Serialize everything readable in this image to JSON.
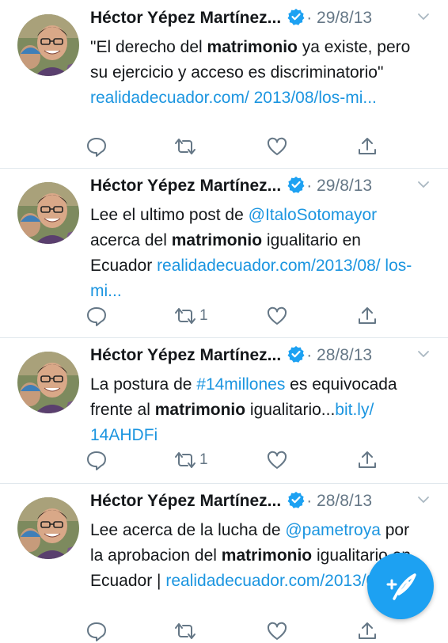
{
  "tweets": [
    {
      "author": "Héctor Yépez Martínez...",
      "date": "· 29/8/13",
      "text": [
        {
          "t": "\"El derecho del ",
          "k": "n"
        },
        {
          "t": "matrimonio",
          "k": "b"
        },
        {
          "t": " ya existe, pero su ejercicio y acceso es discriminatorio\" ",
          "k": "n"
        },
        {
          "t": "realidadecuador.com/ 2013/08/los-mi...",
          "k": "l"
        }
      ],
      "retweet_count": "",
      "like_count": ""
    },
    {
      "author": "Héctor Yépez Martínez...",
      "date": "· 29/8/13",
      "text": [
        {
          "t": "Lee el ultimo post de ",
          "k": "n"
        },
        {
          "t": "@ItaloSotomayor",
          "k": "l"
        },
        {
          "t": " acerca del ",
          "k": "n"
        },
        {
          "t": "matrimonio",
          "k": "b"
        },
        {
          "t": " igualitario en Ecuador ",
          "k": "n"
        },
        {
          "t": "realidadecuador.com/2013/08/ los-mi...",
          "k": "l"
        }
      ],
      "retweet_count": "1",
      "like_count": ""
    },
    {
      "author": "Héctor Yépez Martínez...",
      "date": "· 28/8/13",
      "text": [
        {
          "t": "La postura de ",
          "k": "n"
        },
        {
          "t": "#14millones",
          "k": "l"
        },
        {
          "t": " es equivocada frente al ",
          "k": "n"
        },
        {
          "t": "matrimonio",
          "k": "b"
        },
        {
          "t": " igualitario...",
          "k": "n"
        },
        {
          "t": "bit.ly/ 14AHDFi",
          "k": "l"
        }
      ],
      "retweet_count": "1",
      "like_count": ""
    },
    {
      "author": "Héctor Yépez Martínez...",
      "date": "· 28/8/13",
      "text": [
        {
          "t": "Lee acerca de la lucha de ",
          "k": "n"
        },
        {
          "t": "@pametroya",
          "k": "l"
        },
        {
          "t": " por la aprobacion del ",
          "k": "n"
        },
        {
          "t": "matrimonio",
          "k": "b"
        },
        {
          "t": " igualitario en Ecuador | ",
          "k": "n"
        },
        {
          "t": "realidadecuador.com/2013/08/los-",
          "k": "l"
        }
      ],
      "retweet_count": "",
      "like_count": ""
    }
  ],
  "icons": {
    "reply": "reply-icon",
    "retweet": "retweet-icon",
    "like": "heart-icon",
    "share": "share-icon",
    "verified": "verified-badge-icon",
    "caret": "chevron-down-icon",
    "compose": "compose-tweet-icon"
  },
  "colors": {
    "accent": "#1da1f2",
    "link": "#1b95e0",
    "muted": "#657786",
    "text": "#14171a",
    "divider": "#e1e8ed"
  }
}
